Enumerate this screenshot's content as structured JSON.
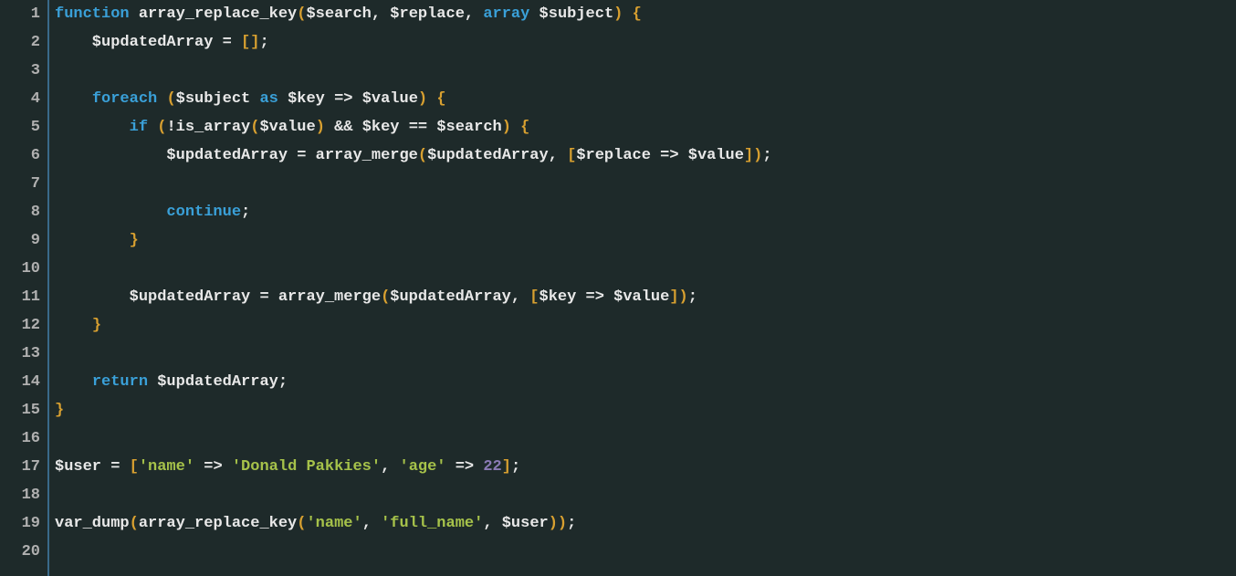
{
  "lineCount": 20,
  "lines": {
    "l1": [
      {
        "t": "function ",
        "c": "tk-keyword"
      },
      {
        "t": "array_replace_key",
        "c": "tk-func"
      },
      {
        "t": "(",
        "c": "tk-paren"
      },
      {
        "t": "$search",
        "c": "tk-var"
      },
      {
        "t": ", ",
        "c": "tk-punct"
      },
      {
        "t": "$replace",
        "c": "tk-var"
      },
      {
        "t": ", ",
        "c": "tk-punct"
      },
      {
        "t": "array ",
        "c": "tk-keyword"
      },
      {
        "t": "$subject",
        "c": "tk-var"
      },
      {
        "t": ") {",
        "c": "tk-paren"
      }
    ],
    "l2": [
      {
        "t": "    $updatedArray ",
        "c": "tk-var"
      },
      {
        "t": "= ",
        "c": "tk-op"
      },
      {
        "t": "[]",
        "c": "tk-paren"
      },
      {
        "t": ";",
        "c": "tk-punct"
      }
    ],
    "l3": [],
    "l4": [
      {
        "t": "    ",
        "c": "tk-default"
      },
      {
        "t": "foreach ",
        "c": "tk-keyword"
      },
      {
        "t": "(",
        "c": "tk-paren"
      },
      {
        "t": "$subject ",
        "c": "tk-var"
      },
      {
        "t": "as ",
        "c": "tk-keyword"
      },
      {
        "t": "$key ",
        "c": "tk-var"
      },
      {
        "t": "=> ",
        "c": "tk-op"
      },
      {
        "t": "$value",
        "c": "tk-var"
      },
      {
        "t": ") {",
        "c": "tk-paren"
      }
    ],
    "l5": [
      {
        "t": "        ",
        "c": "tk-default"
      },
      {
        "t": "if ",
        "c": "tk-keyword"
      },
      {
        "t": "(",
        "c": "tk-paren"
      },
      {
        "t": "!",
        "c": "tk-op"
      },
      {
        "t": "is_array",
        "c": "tk-func"
      },
      {
        "t": "(",
        "c": "tk-paren"
      },
      {
        "t": "$value",
        "c": "tk-var"
      },
      {
        "t": ")",
        "c": "tk-paren"
      },
      {
        "t": " && ",
        "c": "tk-op"
      },
      {
        "t": "$key ",
        "c": "tk-var"
      },
      {
        "t": "== ",
        "c": "tk-op"
      },
      {
        "t": "$search",
        "c": "tk-var"
      },
      {
        "t": ") {",
        "c": "tk-paren"
      }
    ],
    "l6": [
      {
        "t": "            $updatedArray ",
        "c": "tk-var"
      },
      {
        "t": "= ",
        "c": "tk-op"
      },
      {
        "t": "array_merge",
        "c": "tk-func"
      },
      {
        "t": "(",
        "c": "tk-paren"
      },
      {
        "t": "$updatedArray",
        "c": "tk-var"
      },
      {
        "t": ", ",
        "c": "tk-punct"
      },
      {
        "t": "[",
        "c": "tk-paren"
      },
      {
        "t": "$replace ",
        "c": "tk-var"
      },
      {
        "t": "=> ",
        "c": "tk-op"
      },
      {
        "t": "$value",
        "c": "tk-var"
      },
      {
        "t": "])",
        "c": "tk-paren"
      },
      {
        "t": ";",
        "c": "tk-punct"
      }
    ],
    "l7": [],
    "l8": [
      {
        "t": "            ",
        "c": "tk-default"
      },
      {
        "t": "continue",
        "c": "tk-keyword"
      },
      {
        "t": ";",
        "c": "tk-punct"
      }
    ],
    "l9": [
      {
        "t": "        ",
        "c": "tk-default"
      },
      {
        "t": "}",
        "c": "tk-paren"
      }
    ],
    "l10": [],
    "l11": [
      {
        "t": "        $updatedArray ",
        "c": "tk-var"
      },
      {
        "t": "= ",
        "c": "tk-op"
      },
      {
        "t": "array_merge",
        "c": "tk-func"
      },
      {
        "t": "(",
        "c": "tk-paren"
      },
      {
        "t": "$updatedArray",
        "c": "tk-var"
      },
      {
        "t": ", ",
        "c": "tk-punct"
      },
      {
        "t": "[",
        "c": "tk-paren"
      },
      {
        "t": "$key ",
        "c": "tk-var"
      },
      {
        "t": "=> ",
        "c": "tk-op"
      },
      {
        "t": "$value",
        "c": "tk-var"
      },
      {
        "t": "])",
        "c": "tk-paren"
      },
      {
        "t": ";",
        "c": "tk-punct"
      }
    ],
    "l12": [
      {
        "t": "    ",
        "c": "tk-default"
      },
      {
        "t": "}",
        "c": "tk-paren"
      }
    ],
    "l13": [],
    "l14": [
      {
        "t": "    ",
        "c": "tk-default"
      },
      {
        "t": "return ",
        "c": "tk-keyword"
      },
      {
        "t": "$updatedArray",
        "c": "tk-var"
      },
      {
        "t": ";",
        "c": "tk-punct"
      }
    ],
    "l15": [
      {
        "t": "}",
        "c": "tk-paren"
      }
    ],
    "l16": [],
    "l17": [
      {
        "t": "$user ",
        "c": "tk-var"
      },
      {
        "t": "= ",
        "c": "tk-op"
      },
      {
        "t": "[",
        "c": "tk-paren"
      },
      {
        "t": "'name'",
        "c": "tk-string"
      },
      {
        "t": " => ",
        "c": "tk-op"
      },
      {
        "t": "'Donald Pakkies'",
        "c": "tk-string"
      },
      {
        "t": ", ",
        "c": "tk-punct"
      },
      {
        "t": "'age'",
        "c": "tk-string"
      },
      {
        "t": " => ",
        "c": "tk-op"
      },
      {
        "t": "22",
        "c": "tk-number"
      },
      {
        "t": "]",
        "c": "tk-paren"
      },
      {
        "t": ";",
        "c": "tk-punct"
      }
    ],
    "l18": [],
    "l19": [
      {
        "t": "var_dump",
        "c": "tk-func"
      },
      {
        "t": "(",
        "c": "tk-paren"
      },
      {
        "t": "array_replace_key",
        "c": "tk-func"
      },
      {
        "t": "(",
        "c": "tk-paren"
      },
      {
        "t": "'name'",
        "c": "tk-string"
      },
      {
        "t": ", ",
        "c": "tk-punct"
      },
      {
        "t": "'full_name'",
        "c": "tk-string"
      },
      {
        "t": ", ",
        "c": "tk-punct"
      },
      {
        "t": "$user",
        "c": "tk-var"
      },
      {
        "t": "))",
        "c": "tk-paren"
      },
      {
        "t": ";",
        "c": "tk-punct"
      }
    ],
    "l20": []
  }
}
